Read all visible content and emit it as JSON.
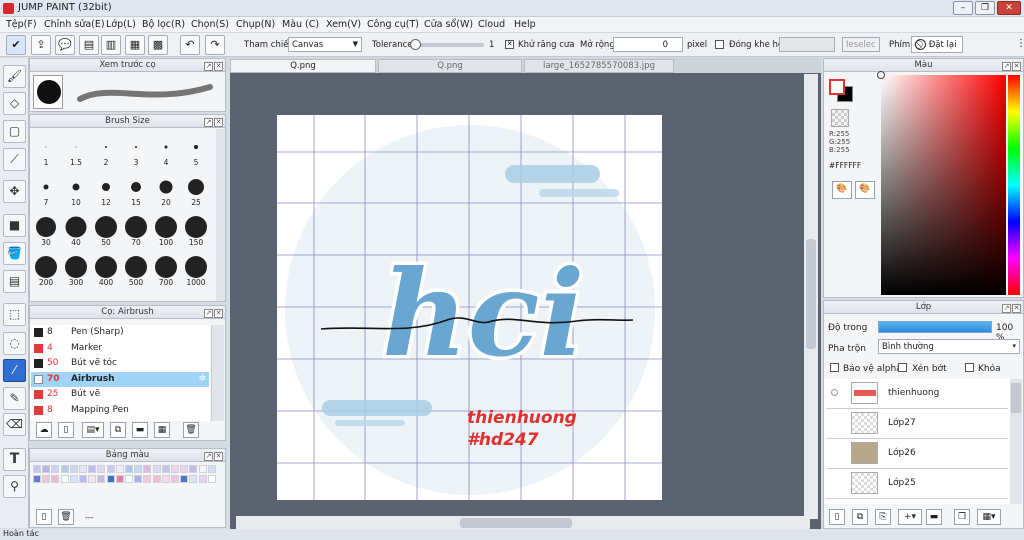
{
  "window": {
    "title": "JUMP PAINT (32bit)"
  },
  "menu": [
    "Tệp(F)",
    "Chỉnh sửa(E)",
    "Lớp(L)",
    "Bộ lọc(R)",
    "Chọn(S)",
    "Chụp(N)",
    "Màu (C)",
    "Xem(V)",
    "Công cụ(T)",
    "Cửa sổ(W)",
    "Cloud",
    "Help"
  ],
  "toolbar": {
    "reference_label": "Tham chiếu",
    "reference_value": "Canvas",
    "tolerance_label": "Tolerance",
    "tolerance_value": "1",
    "antialias_label": "Khử răng cưa",
    "expand_label": "Mở rộng",
    "expand_value": "0",
    "expand_unit": "pixel",
    "close_gap_label": "Đóng khe hở",
    "deselect_label": "Ieselec",
    "shortcut_label": "Phím",
    "reset_label": "Đặt lại"
  },
  "brush_preview": {
    "title": "Xem trước cọ"
  },
  "brush_size": {
    "title": "Brush Size",
    "sizes": [
      "1",
      "1.5",
      "2",
      "3",
      "4",
      "5",
      "7",
      "10",
      "12",
      "15",
      "20",
      "25",
      "30",
      "40",
      "50",
      "70",
      "100",
      "150",
      "200",
      "300",
      "400",
      "500",
      "700",
      "1000"
    ]
  },
  "brush_list": {
    "title": "Cọ: Airbrush",
    "items": [
      {
        "size": "8",
        "name": "Pen (Sharp)"
      },
      {
        "size": "4",
        "name": "Marker"
      },
      {
        "size": "50",
        "name": "Bút vẽ tóc"
      },
      {
        "size": "70",
        "name": "Airbrush"
      },
      {
        "size": "25",
        "name": "Bút vẽ"
      },
      {
        "size": "8",
        "name": "Mapping Pen"
      }
    ],
    "selected_index": 3
  },
  "palette": {
    "title": "Bảng màu",
    "more": "---",
    "colors": [
      "#c6c4f0",
      "#b6b0ea",
      "#d3cff4",
      "#b7c8ee",
      "#cfd4f3",
      "#e6e2f7",
      "#bfbaf0",
      "#e2d5f2",
      "#c9c7ee",
      "#f1eaf6",
      "#a7c7ee",
      "#c6d6f3",
      "#e5b8d8",
      "#dcd9f2",
      "#c6c0ee",
      "#f2d3e7",
      "#e9d2ee",
      "#c7b9ea",
      "#f7f7fb",
      "#d6d9f2",
      "#6b78d6",
      "#f5c2d6",
      "#eeb8d0",
      "#ffffff",
      "#d6e3f6",
      "#b9bbf0",
      "#f4e5ef",
      "#c7b9e6",
      "#3d72c9",
      "#e37fa9",
      "#ffffff",
      "#aab2ee",
      "#f0c9dd",
      "#f5bad3",
      "#f7dbe5",
      "#eec4e0",
      "#4b74cc",
      "#e1e5f3",
      "#e8d3ee",
      "#ffffff"
    ]
  },
  "tabs": [
    "Q.png",
    "Q.png",
    "large_1652785570083.jpg"
  ],
  "artwork": {
    "title_text": "hci",
    "signature_line1": "thienhuong",
    "signature_line2": "#hd247"
  },
  "color_panel": {
    "title": "Màu",
    "r": "R:255",
    "g": "G:255",
    "b": "B:255",
    "hex": "#FFFFFF",
    "foreground": "#ffffff",
    "background": "#000000"
  },
  "layer_panel": {
    "title": "Lớp",
    "opacity_label": "Độ trong",
    "opacity_value": "100 %",
    "opacity_fraction": 1.0,
    "blend_label": "Pha trộn",
    "blend_value": "Bình thường",
    "protect_alpha_label": "Bảo vệ alpha",
    "clip_label": "Xén bớt",
    "lock_label": "Khóa",
    "layers": [
      "thienhuong",
      "Lớp27",
      "Lớp26",
      "Lớp25"
    ]
  },
  "status": "Hoàn tác"
}
